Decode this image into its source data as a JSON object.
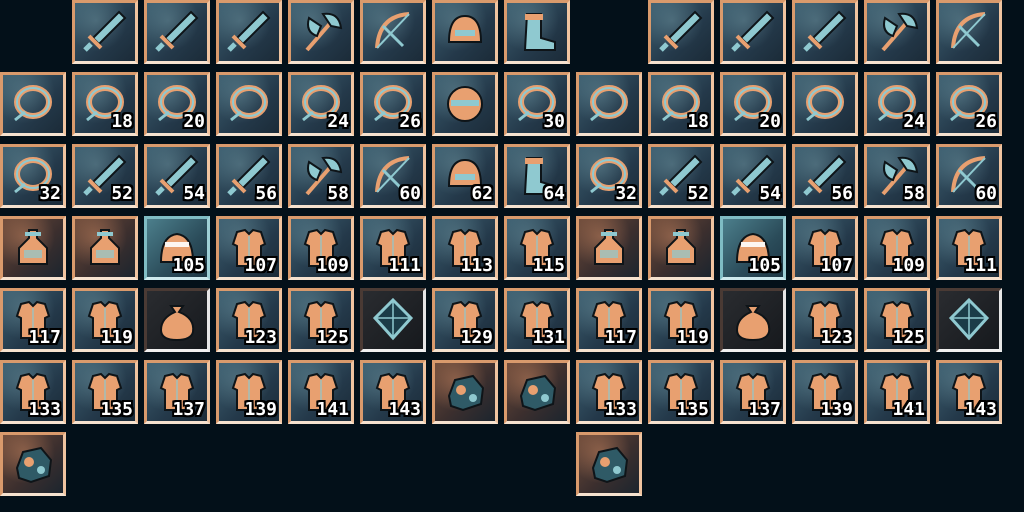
{
  "sheets": [
    {
      "rows": [
        {
          "slots": [
            {
              "icon": "sword",
              "num": ""
            },
            {
              "icon": "sword",
              "num": ""
            },
            {
              "icon": "sword",
              "num": ""
            },
            {
              "icon": "axe",
              "num": ""
            },
            {
              "icon": "bow",
              "num": ""
            },
            {
              "icon": "helmet",
              "num": ""
            },
            {
              "icon": "boot",
              "num": ""
            }
          ]
        },
        {
          "slots": [
            {
              "icon": "ring",
              "num": ""
            },
            {
              "icon": "ring",
              "num": "18"
            },
            {
              "icon": "ring",
              "num": "20"
            },
            {
              "icon": "ring",
              "num": ""
            },
            {
              "icon": "ring",
              "num": "24"
            },
            {
              "icon": "ring",
              "num": "26"
            },
            {
              "icon": "orb",
              "num": ""
            },
            {
              "icon": "ring",
              "num": "30"
            }
          ]
        },
        {
          "slots": [
            {
              "icon": "ring",
              "num": "32"
            },
            {
              "icon": "sword",
              "num": "52"
            },
            {
              "icon": "sword",
              "num": "54"
            },
            {
              "icon": "sword",
              "num": "56"
            },
            {
              "icon": "axe",
              "num": "58"
            },
            {
              "icon": "bow",
              "num": "60"
            },
            {
              "icon": "helmet",
              "num": "62"
            },
            {
              "icon": "boot",
              "num": "64"
            }
          ]
        },
        {
          "slots": [
            {
              "icon": "potion",
              "num": ""
            },
            {
              "icon": "potion",
              "num": ""
            },
            {
              "icon": "crown",
              "num": "105"
            },
            {
              "icon": "armor",
              "num": "107"
            },
            {
              "icon": "armor",
              "num": "109"
            },
            {
              "icon": "armor",
              "num": "111"
            },
            {
              "icon": "armor",
              "num": "113"
            },
            {
              "icon": "armor",
              "num": "115"
            }
          ]
        },
        {
          "slots": [
            {
              "icon": "armor",
              "num": "117"
            },
            {
              "icon": "armor",
              "num": "119"
            },
            {
              "icon": "bag",
              "num": ""
            },
            {
              "icon": "armor",
              "num": "123"
            },
            {
              "icon": "armor",
              "num": "125"
            },
            {
              "icon": "crystal",
              "num": ""
            },
            {
              "icon": "armor",
              "num": "129"
            },
            {
              "icon": "armor",
              "num": "131"
            }
          ]
        },
        {
          "slots": [
            {
              "icon": "armor",
              "num": "133"
            },
            {
              "icon": "armor",
              "num": "135"
            },
            {
              "icon": "armor",
              "num": "137"
            },
            {
              "icon": "armor",
              "num": "139"
            },
            {
              "icon": "armor",
              "num": "141"
            },
            {
              "icon": "armor",
              "num": "143"
            },
            {
              "icon": "rock",
              "num": ""
            },
            {
              "icon": "rock",
              "num": ""
            }
          ]
        },
        {
          "slots": [
            {
              "icon": "rock",
              "num": ""
            }
          ]
        }
      ]
    },
    {
      "rows": [
        {
          "slots": [
            {
              "icon": "sword",
              "num": ""
            },
            {
              "icon": "sword",
              "num": ""
            },
            {
              "icon": "sword",
              "num": ""
            },
            {
              "icon": "axe",
              "num": ""
            },
            {
              "icon": "bow",
              "num": ""
            }
          ]
        },
        {
          "slots": [
            {
              "icon": "ring",
              "num": ""
            },
            {
              "icon": "ring",
              "num": "18"
            },
            {
              "icon": "ring",
              "num": "20"
            },
            {
              "icon": "ring",
              "num": ""
            },
            {
              "icon": "ring",
              "num": "24"
            },
            {
              "icon": "ring",
              "num": "26"
            }
          ]
        },
        {
          "slots": [
            {
              "icon": "ring",
              "num": "32"
            },
            {
              "icon": "sword",
              "num": "52"
            },
            {
              "icon": "sword",
              "num": "54"
            },
            {
              "icon": "sword",
              "num": "56"
            },
            {
              "icon": "axe",
              "num": "58"
            },
            {
              "icon": "bow",
              "num": "60"
            }
          ]
        },
        {
          "slots": [
            {
              "icon": "potion",
              "num": ""
            },
            {
              "icon": "potion",
              "num": ""
            },
            {
              "icon": "crown",
              "num": "105"
            },
            {
              "icon": "armor",
              "num": "107"
            },
            {
              "icon": "armor",
              "num": "109"
            },
            {
              "icon": "armor",
              "num": "111"
            }
          ]
        },
        {
          "slots": [
            {
              "icon": "armor",
              "num": "117"
            },
            {
              "icon": "armor",
              "num": "119"
            },
            {
              "icon": "bag",
              "num": ""
            },
            {
              "icon": "armor",
              "num": "123"
            },
            {
              "icon": "armor",
              "num": "125"
            },
            {
              "icon": "crystal",
              "num": ""
            }
          ]
        },
        {
          "slots": [
            {
              "icon": "armor",
              "num": "133"
            },
            {
              "icon": "armor",
              "num": "135"
            },
            {
              "icon": "armor",
              "num": "137"
            },
            {
              "icon": "armor",
              "num": "139"
            },
            {
              "icon": "armor",
              "num": "141"
            },
            {
              "icon": "armor",
              "num": "143"
            }
          ]
        },
        {
          "slots": [
            {
              "icon": "rock",
              "num": ""
            }
          ]
        }
      ]
    }
  ],
  "colors": {
    "background": "#031019",
    "frame": "#d99a6c",
    "steel": "#8fc9d0",
    "copper": "#e8a070",
    "ink": "#0e1418"
  }
}
